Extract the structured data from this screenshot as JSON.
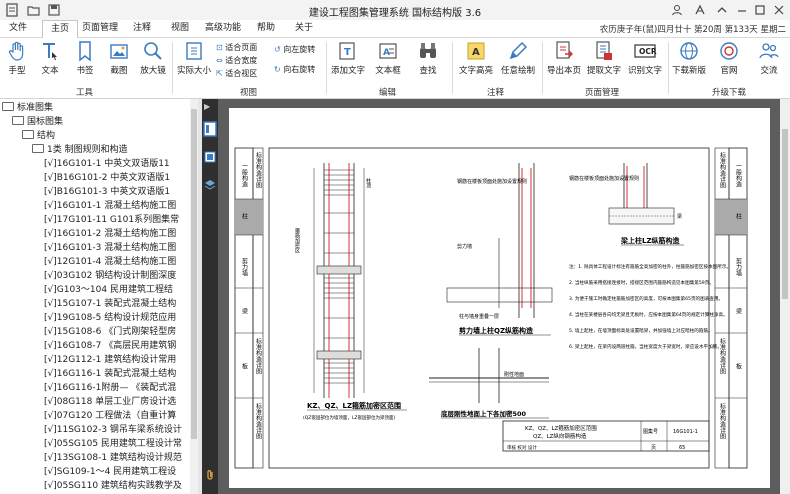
{
  "app": {
    "title": "建设工程图集管理系统  国标结构版 3.6",
    "date_info": "农历庚子年(鼠)四月廿十 第20周 第133天 星期二"
  },
  "menu": [
    {
      "label": "文件"
    },
    {
      "label": "主页"
    },
    {
      "label": "页面管理"
    },
    {
      "label": "注释"
    },
    {
      "label": "视图"
    },
    {
      "label": "高级功能"
    },
    {
      "label": "帮助"
    },
    {
      "label": "关于"
    }
  ],
  "ribbon": {
    "tools_group": "工具",
    "view_group": "视图",
    "edit_group": "编辑",
    "annot_group": "注释",
    "page_group": "页面管理",
    "upgrade_group": "升级下载",
    "hand": "手型",
    "text": "文本",
    "bookmark": "书签",
    "screenshot": "截图",
    "magnifier": "放大镜",
    "actual_size": "实际大小",
    "fit_page": "适合页面",
    "fit_width": "适合宽度",
    "fit_view": "适合视区",
    "rotate_left": "向左旋转",
    "rotate_right": "向右旋转",
    "add_text": "添加文字",
    "text_box": "文本框",
    "find": "查找",
    "text_highlight": "文字高亮",
    "freehand": "任意绘制",
    "export_page": "导出本页",
    "extract_text": "提取文字",
    "ocr": "识别文字",
    "download": "下载新版",
    "website": "官网",
    "communicate": "交流",
    "ocr_badge": "OCR"
  },
  "tree": {
    "root": "标准图集",
    "l1": "国标图集",
    "l2": "结构",
    "l3": "1类 制图规则和构造",
    "items": [
      "[√]16G101-1 中英文双语版11",
      "[√]B16G101-2 中英文双语版1",
      "[√]B16G101-3 中英文双语版1",
      "[√]16G101-1 混凝土结构施工图",
      "[√]17G101-11 G101系列图集常",
      "[√]16G101-2 混凝土结构施工图",
      "[√]16G101-3 混凝土结构施工图",
      "[√]12G101-4 混凝土结构施工图",
      "[√]03G102 钢结构设计制图深度",
      "[√]G103～104 民用建筑工程结",
      "[√]15G107-1 装配式混凝土结构",
      "[√]19G108-5 结构设计规范应用",
      "[√]15G108-6 《门式刚架轻型房",
      "[√]16G108-7 《高层民用建筑钢",
      "[√]12G112-1 建筑结构设计常用",
      "[√]16G116-1 装配式混凝土结构",
      "[√]16G116-1附册— 《装配式混",
      "[√]08G118 单层工业厂房设计选",
      "[√]07G120 工程做法（自重计算",
      "[√]11SG102-3 钢吊车梁系统设计",
      "[√]05SG105 民用建筑工程设计常",
      "[√]13SG108-1 建筑结构设计规范",
      "[√]SG109-1～4 民用建筑工程设",
      "[√]05SG110 建筑结构实践教学及"
    ]
  },
  "drawing": {
    "title1": "KZ、QZ、LZ箍筋加密区范围",
    "note1": "(QZ嵌固部位为墙顶面，LZ嵌固部位为梁顶面)",
    "title2": "剪力墙上柱QZ纵筋构造",
    "title3": "梁上柱LZ纵筋构造",
    "title4": "底层刚性地面上下各加密500",
    "label_hoop": "箍筋加密区",
    "label_col_top": "柱顶",
    "label_wall_top": "墙顶面",
    "label_beam_top": "梁顶面",
    "label_ground": "刚性地面",
    "label_slab_top": "柱与墙身重叠一层",
    "label_beam": "梁",
    "annot_wall_hoop": "钢筋在楼板顶面处施加设置规则",
    "label_wall": "剪力墙",
    "notes": [
      "注：1. 除具体工程设计标注有箍筋全高加密的柱外，柱箍筋加密区按本图所示。",
      "2. 当柱纵筋采用搭接连接时，搭接区范围内箍筋构造见本图集第59页。",
      "3. 为便于施工时确定柱箍筋加密区的高度，可按本图集第65页的图表查用。",
      "4. 当柱在某楼层各向均无梁且无板时，应按本图集第64页的规定计算柱净高。",
      "5. 墙上起柱，在墙顶面标高处设置暗梁，并加强墙上对应暗柱的箍筋。",
      "6. 梁上起柱，在梁内设两道柱箍，当柱宽度大于梁宽时，梁应设水平加腋。"
    ],
    "tb_title": "KZ、QZ、LZ箍筋加密区范围",
    "tb_title2": "QZ、LZ纵向钢筋构造",
    "tb_atlas_label": "图集号",
    "tb_atlas": "16G101-1",
    "tb_page_label": "页",
    "tb_page": "65",
    "tb_sign": "审核 校对 设计",
    "left_col": [
      "一般构造",
      "标准构造详图",
      "柱",
      "剪力墙",
      "梁",
      "标准构造详图",
      "标准构造详图",
      "板"
    ],
    "right_col": [
      "一般构造",
      "标准构造详图",
      "柱",
      "剪力墙",
      "梁",
      "标准构造详图",
      "标准构造详图",
      "板"
    ]
  }
}
